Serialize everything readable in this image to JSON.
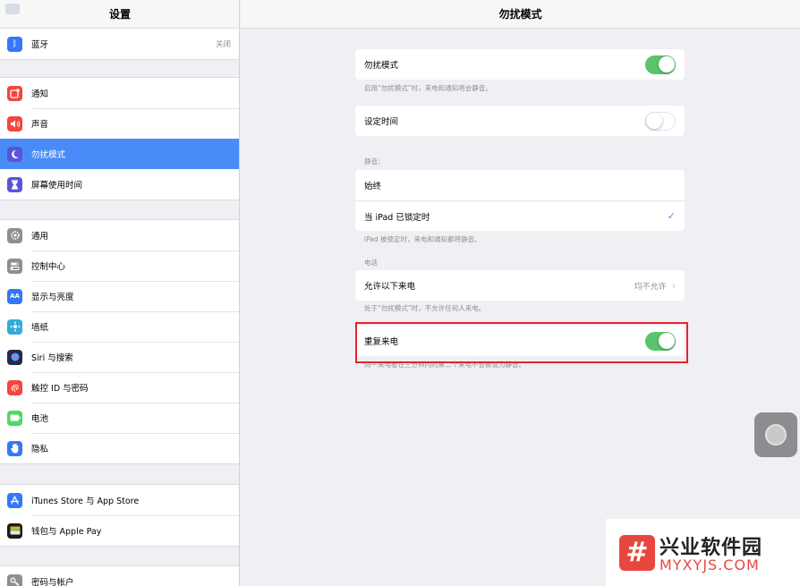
{
  "sidebar": {
    "title": "设置",
    "bluetooth": {
      "label": "蓝牙",
      "value": "关闭",
      "icon": "bluetooth-icon",
      "color": "#3478f6"
    },
    "group1": [
      {
        "label": "通知",
        "icon": "notifications-icon",
        "color": "#f5453d"
      },
      {
        "label": "声音",
        "icon": "sound-icon",
        "color": "#f5453d"
      },
      {
        "label": "勿扰模式",
        "icon": "moon-icon",
        "color": "#5a55d6",
        "active": true
      },
      {
        "label": "屏幕使用时间",
        "icon": "hourglass-icon",
        "color": "#5a55d6"
      }
    ],
    "group2": [
      {
        "label": "通用",
        "icon": "gear-icon",
        "color": "#8e8e93"
      },
      {
        "label": "控制中心",
        "icon": "control-center-icon",
        "color": "#8e8e93"
      },
      {
        "label": "显示与亮度",
        "icon": "display-icon",
        "color": "#3478f6"
      },
      {
        "label": "墙纸",
        "icon": "wallpaper-icon",
        "color": "#35aadc"
      },
      {
        "label": "Siri 与搜索",
        "icon": "siri-icon",
        "color": "#222a4a"
      },
      {
        "label": "触控 ID 与密码",
        "icon": "fingerprint-icon",
        "color": "#f5453d"
      },
      {
        "label": "电池",
        "icon": "battery-icon",
        "color": "#4cd964"
      },
      {
        "label": "隐私",
        "icon": "hand-icon",
        "color": "#3478f6"
      }
    ],
    "group3": [
      {
        "label": "iTunes Store 与 App Store",
        "icon": "app-store-icon",
        "color": "#3478f6"
      },
      {
        "label": "钱包与 Apple Pay",
        "icon": "wallet-icon",
        "color": "#1c1c1e"
      }
    ],
    "group4": [
      {
        "label": "密码与帐户",
        "icon": "key-icon",
        "color": "#8e8e93"
      }
    ]
  },
  "main": {
    "title": "勿扰模式",
    "dnd": {
      "label": "勿扰模式",
      "on": true,
      "footer": "启用“勿扰模式”时，来电和通知将会静音。"
    },
    "scheduled": {
      "label": "设定时间",
      "on": false
    },
    "silence": {
      "header": "静音：",
      "always": "始终",
      "locked": "当 iPad 已锁定时",
      "footer": "iPad 被锁定时，来电和通知都将静音。"
    },
    "phone": {
      "header": "电话",
      "allow_label": "允许以下来电",
      "allow_value": "均不允许",
      "footer": "处于“勿扰模式”时，不允许任何人来电。"
    },
    "repeated": {
      "label": "重复来电",
      "on": true,
      "footer": "同一来电者在三分钟内的第二个来电不会被设为静音。"
    }
  },
  "watermark": {
    "cn": "兴业软件园",
    "en": "MYXYJS.COM",
    "logo": "#"
  },
  "colors": {
    "accent": "#4a8cf7",
    "toggle_on": "#59c46c",
    "highlight": "#e5232d"
  }
}
